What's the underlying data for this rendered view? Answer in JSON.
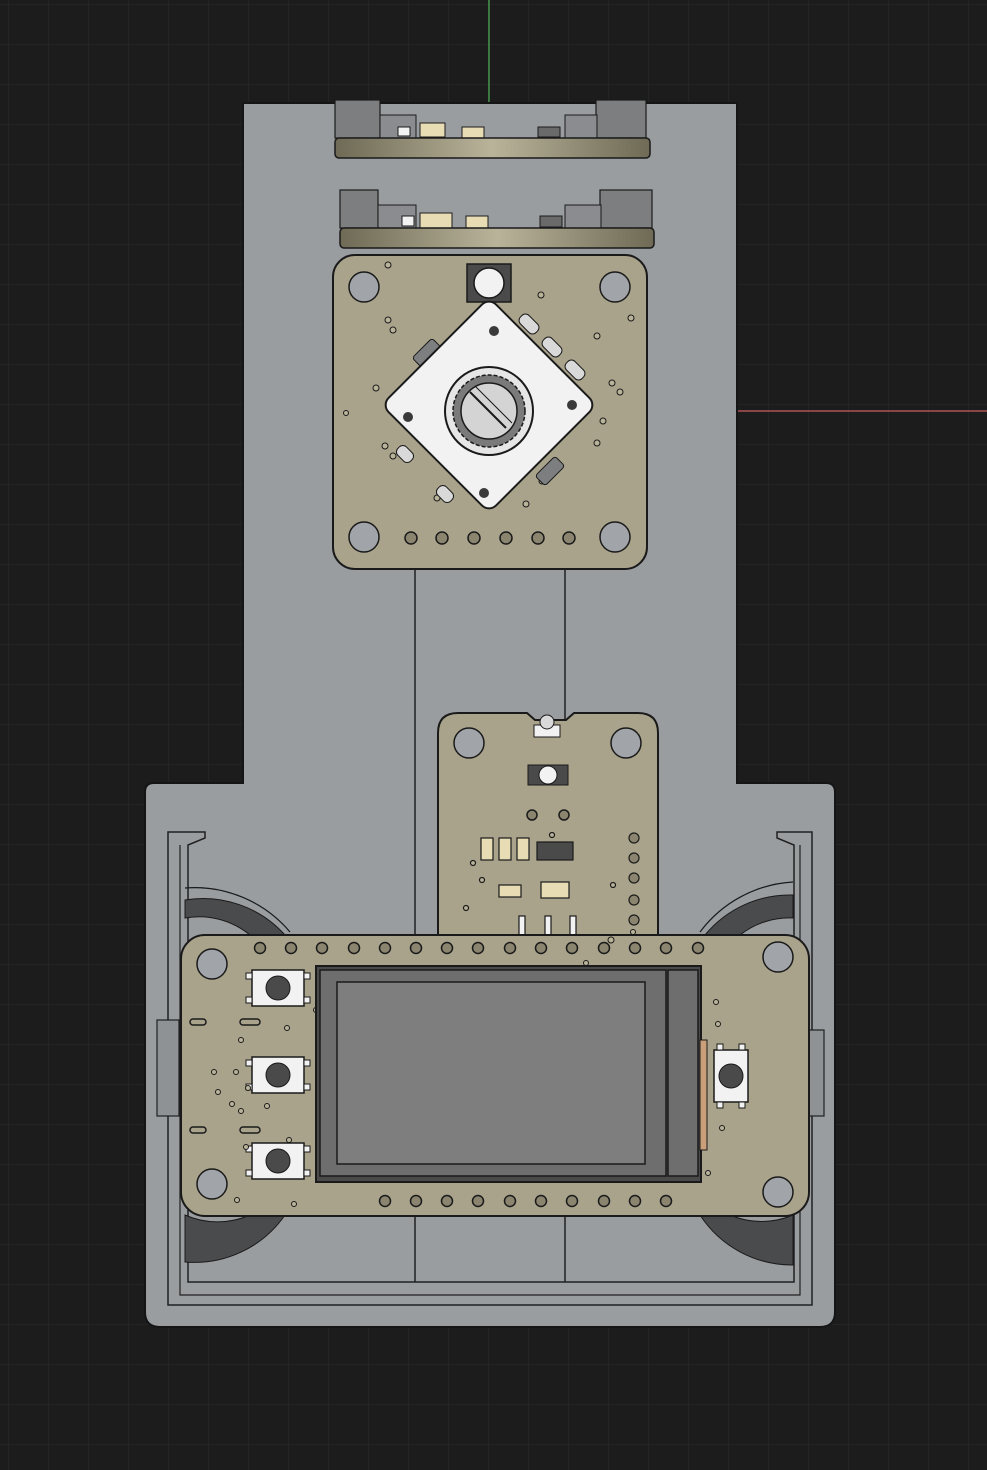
{
  "viewport": {
    "background": "#1c1c1c",
    "grid_color": "#2b2b2b",
    "axis_x_color": "#c86060",
    "axis_y_color": "#4caf50"
  },
  "colors": {
    "enclosure": "#9a9da0",
    "enclosure_edge": "#1a1a1a",
    "pcb": "#a9a38b",
    "pcb_dark": "#8b8570",
    "button_white": "#f2f2f2",
    "lcd_bezel": "#4a4a4a",
    "lcd_screen": "#7e7e7e",
    "knob_gray": "#5a5a5a",
    "smd_pad": "#e8dcb5"
  },
  "icons": {
    "origin": "cad-origin-axes",
    "encoder": "rotary-encoder-module",
    "display": "lcd-display-module",
    "buttons": "tactile-push-button"
  }
}
